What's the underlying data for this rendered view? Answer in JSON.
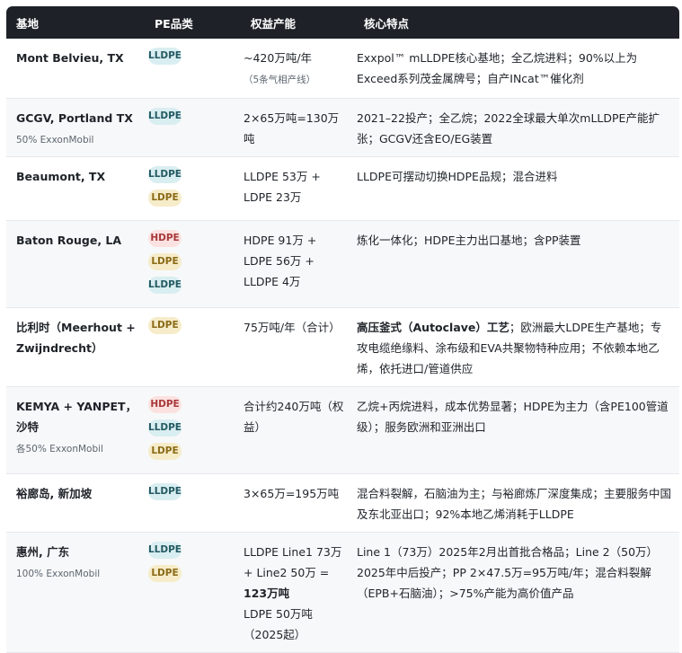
{
  "headers": [
    "基地",
    "PE品类",
    "权益产能",
    "核心特点"
  ],
  "rows": [
    {
      "site": "Mont Belvieu, TX",
      "sub": "",
      "badges": [
        "LLDPE"
      ],
      "capacity": "~420万吨/年",
      "capacity_note": "（5条气相产线）",
      "features": "Exxpol™ mLLDPE核心基地；全乙烷进料；90%以上为Exceed系列茂金属牌号；自产INcat™催化剂"
    },
    {
      "site": "GCGV, Portland TX",
      "sub": "50% ExxonMobil",
      "badges": [
        "LLDPE"
      ],
      "capacity": "2×65万吨=130万吨",
      "features": "2021–22投产；全乙烷；2022全球最大单次mLLDPE产能扩张；GCGV还含EO/EG装置"
    },
    {
      "site": "Beaumont, TX",
      "sub": "",
      "badges": [
        "LLDPE",
        "LDPE"
      ],
      "capacity": "LLDPE 53万 + LDPE 23万",
      "features": "LLDPE可摆动切换HDPE品规；混合进料"
    },
    {
      "site": "Baton Rouge, LA",
      "sub": "",
      "badges": [
        "HDPE",
        "LDPE",
        "LLDPE"
      ],
      "capacity": "HDPE 91万 + LDPE 56万 + LLDPE 4万",
      "features": "炼化一体化；HDPE主力出口基地；含PP装置"
    },
    {
      "site": "比利时（Meerhout + Zwijndrecht）",
      "sub": "",
      "badges": [
        "LDPE"
      ],
      "capacity": "75万吨/年（合计）",
      "features_bold": "高压釜式（Autoclave）工艺",
      "features": "；欧洲最大LDPE生产基地；专攻电缆绝缘料、涂布级和EVA共聚物特种应用；不依赖本地乙烯，依托进口/管道供应"
    },
    {
      "site": "KEMYA + YANPET，沙特",
      "sub": "各50% ExxonMobil",
      "badges": [
        "HDPE",
        "LLDPE",
        "LDPE"
      ],
      "capacity": "合计约240万吨（权益）",
      "features": "乙烷+丙烷进料，成本优势显著；HDPE为主力（含PE100管道级）；服务欧洲和亚洲出口"
    },
    {
      "site": "裕廊岛, 新加坡",
      "sub": "",
      "badges": [
        "LLDPE"
      ],
      "capacity": "3×65万=195万吨",
      "features": "混合料裂解，石脑油为主；与裕廊炼厂深度集成；主要服务中国及东北亚出口；92%本地乙烯消耗于LLDPE"
    },
    {
      "site": "惠州, 广东",
      "sub": "100% ExxonMobil",
      "badges": [
        "LLDPE",
        "LDPE"
      ],
      "capacity_a": "LLDPE Line1 73万 + Line2 50万 = ",
      "capacity_bold": "123万吨",
      "capacity_b": "LDPE 50万吨（2025起）",
      "features": "Line 1（73万）2025年2月出首批合格品；Line 2（50万）2025年中后投产；PP 2×47.5万=95万吨/年；混合料裂解（EPB+石脑油）；>75%产能为高价值产品"
    }
  ]
}
